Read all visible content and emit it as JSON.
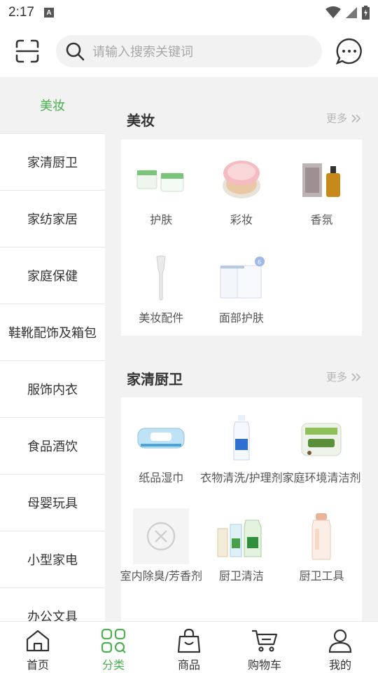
{
  "status_bar": {
    "time": "2:17",
    "notification_letter": "A"
  },
  "search": {
    "placeholder": "请输入搜索关键词"
  },
  "sidebar": {
    "items": [
      {
        "label": "美妆",
        "active": true
      },
      {
        "label": "家清厨卫"
      },
      {
        "label": "家纺家居"
      },
      {
        "label": "家庭保健"
      },
      {
        "label": "鞋靴配饰及箱包"
      },
      {
        "label": "服饰内衣"
      },
      {
        "label": "食品酒饮"
      },
      {
        "label": "母婴玩具"
      },
      {
        "label": "小型家电"
      },
      {
        "label": "办公文具"
      }
    ]
  },
  "sections": [
    {
      "title": "美妆",
      "more": "更多",
      "items": [
        {
          "label": "护肤",
          "icon": "skincare-product-image"
        },
        {
          "label": "彩妆",
          "icon": "cushion-compact-image"
        },
        {
          "label": "香氛",
          "icon": "perfume-bottle-image"
        },
        {
          "label": "美妆配件",
          "icon": "makeup-spatula-image"
        },
        {
          "label": "面部护肤",
          "icon": "face-mask-image"
        }
      ]
    },
    {
      "title": "家清厨卫",
      "more": "更多",
      "items": [
        {
          "label": "纸品湿巾",
          "icon": "wet-wipes-image"
        },
        {
          "label": "衣物清洗/护理剂",
          "icon": "detergent-bottle-image"
        },
        {
          "label": "家庭环境清洁剂",
          "icon": "cleaning-wipes-image"
        },
        {
          "label": "室内除臭/芳香剂",
          "icon": "image-error-placeholder"
        },
        {
          "label": "厨卫清洁",
          "icon": "dish-soap-image"
        },
        {
          "label": "厨卫工具",
          "icon": "water-bottle-image"
        }
      ]
    }
  ],
  "bottom_nav": {
    "items": [
      {
        "label": "首页",
        "icon": "home-icon"
      },
      {
        "label": "分类",
        "icon": "category-icon",
        "active": true
      },
      {
        "label": "商品",
        "icon": "bag-icon"
      },
      {
        "label": "购物车",
        "icon": "cart-icon"
      },
      {
        "label": "我的",
        "icon": "user-icon"
      }
    ]
  },
  "colors": {
    "accent": "#4caf50",
    "background": "#f2f2f2",
    "text": "#333333",
    "muted": "#b5b5b5"
  }
}
